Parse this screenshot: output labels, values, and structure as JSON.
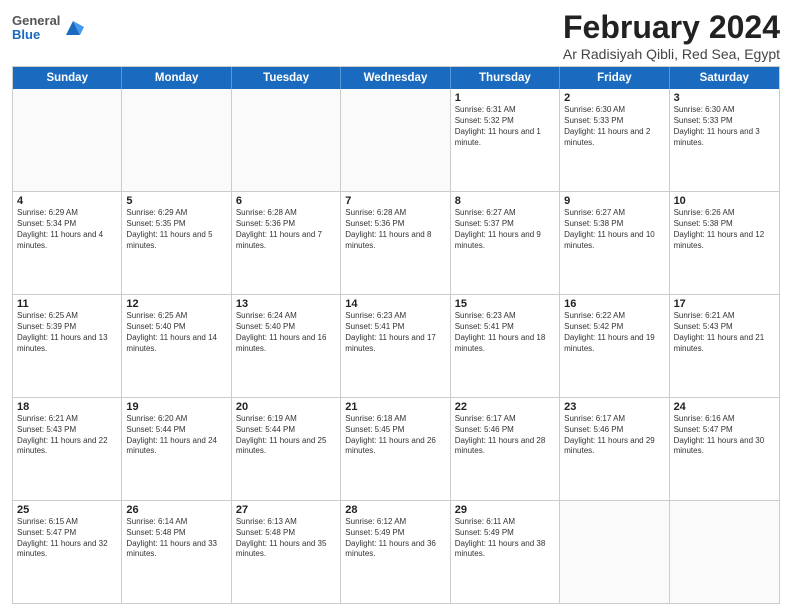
{
  "logo": {
    "general": "General",
    "blue": "Blue"
  },
  "header": {
    "title": "February 2024",
    "subtitle": "Ar Radisiyah Qibli, Red Sea, Egypt"
  },
  "weekdays": [
    "Sunday",
    "Monday",
    "Tuesday",
    "Wednesday",
    "Thursday",
    "Friday",
    "Saturday"
  ],
  "weeks": [
    [
      {
        "day": "",
        "info": ""
      },
      {
        "day": "",
        "info": ""
      },
      {
        "day": "",
        "info": ""
      },
      {
        "day": "",
        "info": ""
      },
      {
        "day": "1",
        "info": "Sunrise: 6:31 AM\nSunset: 5:32 PM\nDaylight: 11 hours and 1 minute."
      },
      {
        "day": "2",
        "info": "Sunrise: 6:30 AM\nSunset: 5:33 PM\nDaylight: 11 hours and 2 minutes."
      },
      {
        "day": "3",
        "info": "Sunrise: 6:30 AM\nSunset: 5:33 PM\nDaylight: 11 hours and 3 minutes."
      }
    ],
    [
      {
        "day": "4",
        "info": "Sunrise: 6:29 AM\nSunset: 5:34 PM\nDaylight: 11 hours and 4 minutes."
      },
      {
        "day": "5",
        "info": "Sunrise: 6:29 AM\nSunset: 5:35 PM\nDaylight: 11 hours and 5 minutes."
      },
      {
        "day": "6",
        "info": "Sunrise: 6:28 AM\nSunset: 5:36 PM\nDaylight: 11 hours and 7 minutes."
      },
      {
        "day": "7",
        "info": "Sunrise: 6:28 AM\nSunset: 5:36 PM\nDaylight: 11 hours and 8 minutes."
      },
      {
        "day": "8",
        "info": "Sunrise: 6:27 AM\nSunset: 5:37 PM\nDaylight: 11 hours and 9 minutes."
      },
      {
        "day": "9",
        "info": "Sunrise: 6:27 AM\nSunset: 5:38 PM\nDaylight: 11 hours and 10 minutes."
      },
      {
        "day": "10",
        "info": "Sunrise: 6:26 AM\nSunset: 5:38 PM\nDaylight: 11 hours and 12 minutes."
      }
    ],
    [
      {
        "day": "11",
        "info": "Sunrise: 6:25 AM\nSunset: 5:39 PM\nDaylight: 11 hours and 13 minutes."
      },
      {
        "day": "12",
        "info": "Sunrise: 6:25 AM\nSunset: 5:40 PM\nDaylight: 11 hours and 14 minutes."
      },
      {
        "day": "13",
        "info": "Sunrise: 6:24 AM\nSunset: 5:40 PM\nDaylight: 11 hours and 16 minutes."
      },
      {
        "day": "14",
        "info": "Sunrise: 6:23 AM\nSunset: 5:41 PM\nDaylight: 11 hours and 17 minutes."
      },
      {
        "day": "15",
        "info": "Sunrise: 6:23 AM\nSunset: 5:41 PM\nDaylight: 11 hours and 18 minutes."
      },
      {
        "day": "16",
        "info": "Sunrise: 6:22 AM\nSunset: 5:42 PM\nDaylight: 11 hours and 19 minutes."
      },
      {
        "day": "17",
        "info": "Sunrise: 6:21 AM\nSunset: 5:43 PM\nDaylight: 11 hours and 21 minutes."
      }
    ],
    [
      {
        "day": "18",
        "info": "Sunrise: 6:21 AM\nSunset: 5:43 PM\nDaylight: 11 hours and 22 minutes."
      },
      {
        "day": "19",
        "info": "Sunrise: 6:20 AM\nSunset: 5:44 PM\nDaylight: 11 hours and 24 minutes."
      },
      {
        "day": "20",
        "info": "Sunrise: 6:19 AM\nSunset: 5:44 PM\nDaylight: 11 hours and 25 minutes."
      },
      {
        "day": "21",
        "info": "Sunrise: 6:18 AM\nSunset: 5:45 PM\nDaylight: 11 hours and 26 minutes."
      },
      {
        "day": "22",
        "info": "Sunrise: 6:17 AM\nSunset: 5:46 PM\nDaylight: 11 hours and 28 minutes."
      },
      {
        "day": "23",
        "info": "Sunrise: 6:17 AM\nSunset: 5:46 PM\nDaylight: 11 hours and 29 minutes."
      },
      {
        "day": "24",
        "info": "Sunrise: 6:16 AM\nSunset: 5:47 PM\nDaylight: 11 hours and 30 minutes."
      }
    ],
    [
      {
        "day": "25",
        "info": "Sunrise: 6:15 AM\nSunset: 5:47 PM\nDaylight: 11 hours and 32 minutes."
      },
      {
        "day": "26",
        "info": "Sunrise: 6:14 AM\nSunset: 5:48 PM\nDaylight: 11 hours and 33 minutes."
      },
      {
        "day": "27",
        "info": "Sunrise: 6:13 AM\nSunset: 5:48 PM\nDaylight: 11 hours and 35 minutes."
      },
      {
        "day": "28",
        "info": "Sunrise: 6:12 AM\nSunset: 5:49 PM\nDaylight: 11 hours and 36 minutes."
      },
      {
        "day": "29",
        "info": "Sunrise: 6:11 AM\nSunset: 5:49 PM\nDaylight: 11 hours and 38 minutes."
      },
      {
        "day": "",
        "info": ""
      },
      {
        "day": "",
        "info": ""
      }
    ]
  ]
}
